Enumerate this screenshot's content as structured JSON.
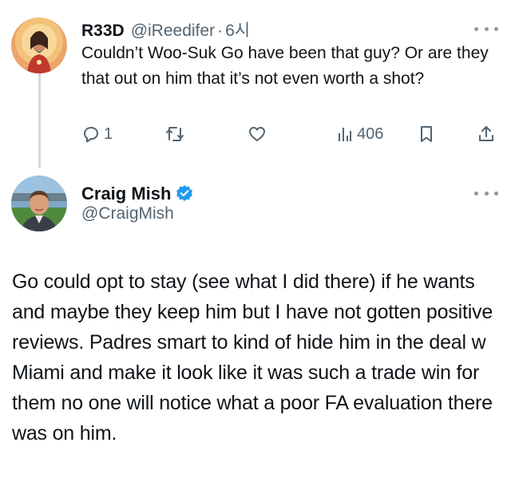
{
  "reply": {
    "display_name": "R33D",
    "handle": "@iReedifer",
    "separator": "·",
    "time": "6시",
    "text": "Couldn’t Woo-Suk Go have been that guy? Or are they that out on him that it’s not even worth a shot?",
    "actions": {
      "reply_count": "1",
      "retweet_count": "",
      "like_count": "",
      "views": "406"
    }
  },
  "main_tweet": {
    "display_name": "Craig Mish",
    "handle": "@CraigMish",
    "verified": true,
    "text": "Go could opt to stay (see what I did there) if he wants and maybe they keep him but I have not gotten positive reviews. Padres smart to kind of hide him in the deal w Miami and make it look like it was such a trade win for them no one will notice what a poor FA evaluation there was on him."
  },
  "colors": {
    "text": "#0f1419",
    "secondary": "#536471",
    "verified": "#1d9bf0",
    "thread_line": "#cfd9de"
  }
}
